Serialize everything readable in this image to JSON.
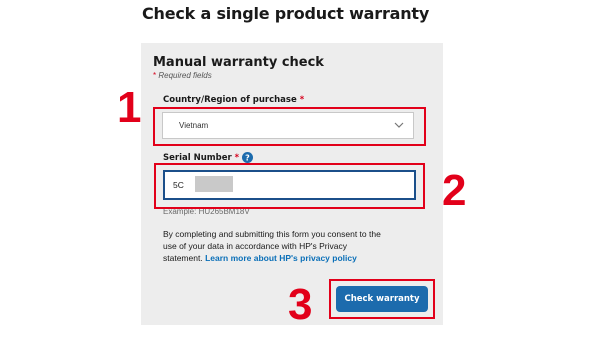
{
  "page": {
    "title": "Check a single product warranty"
  },
  "form": {
    "title": "Manual warranty check",
    "required_star": "*",
    "required_note": "Required fields",
    "country": {
      "label": "Country/Region of purchase",
      "required_star": "*",
      "value": "Vietnam",
      "icon": "chevron-down-icon"
    },
    "serial": {
      "label": "Serial Number",
      "required_star": "*",
      "info_icon": "info-icon",
      "value": "5C",
      "example": "Example: HU265BM18V"
    },
    "consent": {
      "line1": "By completing and submitting this form you consent to the",
      "line2": "use of your data in accordance with HP's Privacy",
      "line3_prefix": "statement.",
      "privacy_link": "Learn more about HP's privacy policy"
    },
    "submit_label": "Check warranty"
  },
  "annotations": {
    "step1": "1",
    "step2": "2",
    "step3": "3",
    "color": "#e2001a"
  },
  "colors": {
    "primary_button": "#1c6bad",
    "link": "#0a6fb8",
    "input_border_focus": "#1b4f8a",
    "panel_background": "#ededed"
  }
}
